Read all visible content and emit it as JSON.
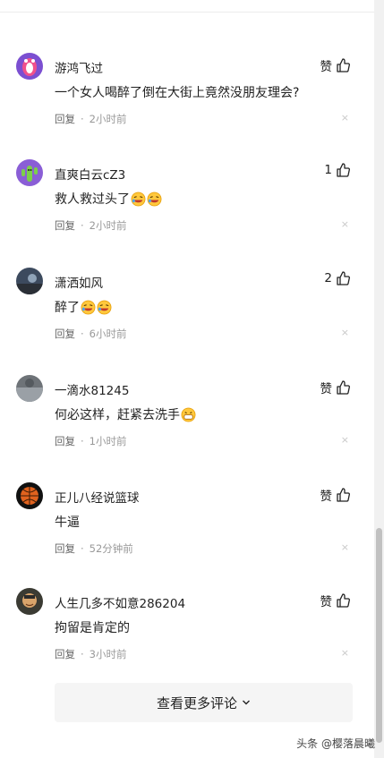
{
  "comments": [
    {
      "username": "游鸿飞过",
      "like_label": "赞",
      "text": "一个女人喝醉了倒在大街上竟然没朋友理会?",
      "reply": "回复",
      "time": "2小时前"
    },
    {
      "username": "直爽白云cZ3",
      "like_label": "1",
      "text": "救人救过头了",
      "reply": "回复",
      "time": "2小时前"
    },
    {
      "username": "潇洒如风",
      "like_label": "2",
      "text": "醉了",
      "reply": "回复",
      "time": "6小时前"
    },
    {
      "username": "一滴水81245",
      "like_label": "赞",
      "text": "何必这样，赶紧去洗手",
      "reply": "回复",
      "time": "1小时前"
    },
    {
      "username": "正儿八经说篮球",
      "like_label": "赞",
      "text": "牛逼",
      "reply": "回复",
      "time": "52分钟前"
    },
    {
      "username": "人生几多不如意286204",
      "like_label": "赞",
      "text": "拘留是肯定的",
      "reply": "回复",
      "time": "3小时前"
    }
  ],
  "meta_separator": "·",
  "close_symbol": "×",
  "more_button": {
    "label": "查看更多评论"
  },
  "watermark": "头条 @樱落晨曦",
  "colors": {
    "text": "#222222",
    "meta": "#999999",
    "button_bg": "#f5f5f5"
  },
  "icons": [
    "thumb-up-icon",
    "close-icon",
    "chevron-down-icon",
    "laughing-emoji-icon",
    "grin-emoji-icon"
  ]
}
